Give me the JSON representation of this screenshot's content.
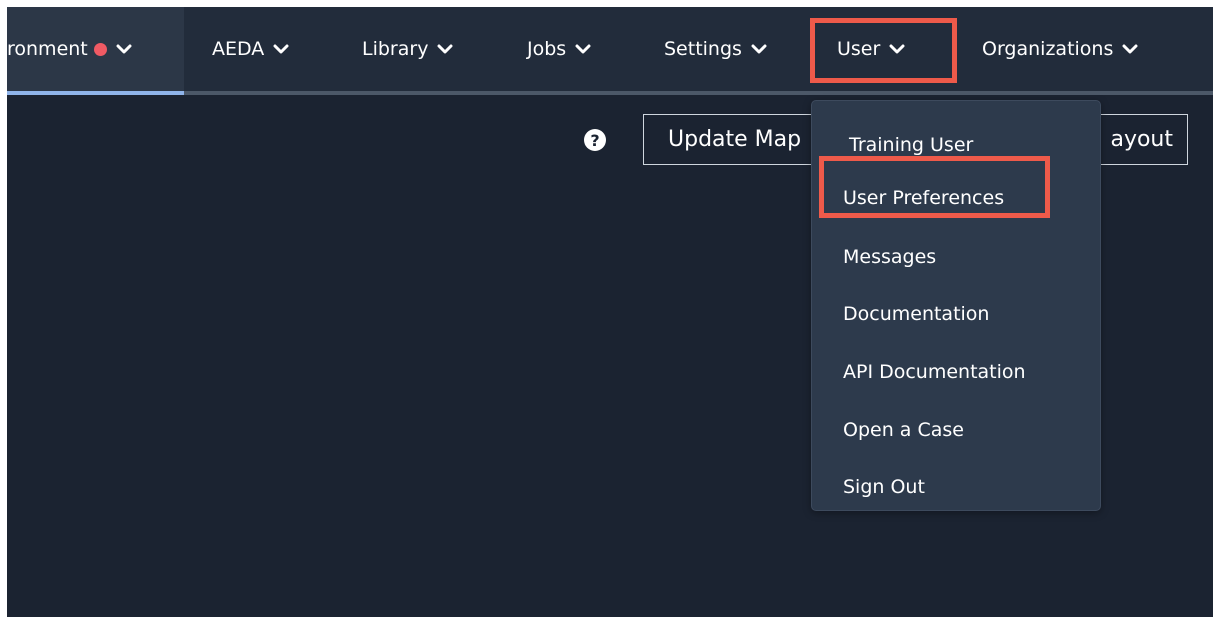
{
  "nav": {
    "items": [
      {
        "label": "ronment",
        "has_dot": true,
        "active": true
      },
      {
        "label": "AEDA"
      },
      {
        "label": "Library"
      },
      {
        "label": "Jobs"
      },
      {
        "label": "Settings"
      },
      {
        "label": "User",
        "highlighted": true
      },
      {
        "label": "Organizations"
      }
    ]
  },
  "toolbar": {
    "help_icon": "question-circle-icon",
    "update_map_label": "Update Map",
    "layout_label": "ayout"
  },
  "user_menu": {
    "header": "Training User",
    "items": [
      {
        "label": "User Preferences",
        "highlighted": true
      },
      {
        "label": "Messages"
      },
      {
        "label": "Documentation"
      },
      {
        "label": "API Documentation"
      },
      {
        "label": "Open a Case"
      },
      {
        "label": "Sign Out"
      }
    ]
  },
  "colors": {
    "background": "#1b2331",
    "navbar": "#222c3b",
    "dropdown": "#2d3a4c",
    "highlight": "#ee5a4a",
    "status_dot": "#f05a64",
    "active_underline": "#8fb4ea"
  }
}
